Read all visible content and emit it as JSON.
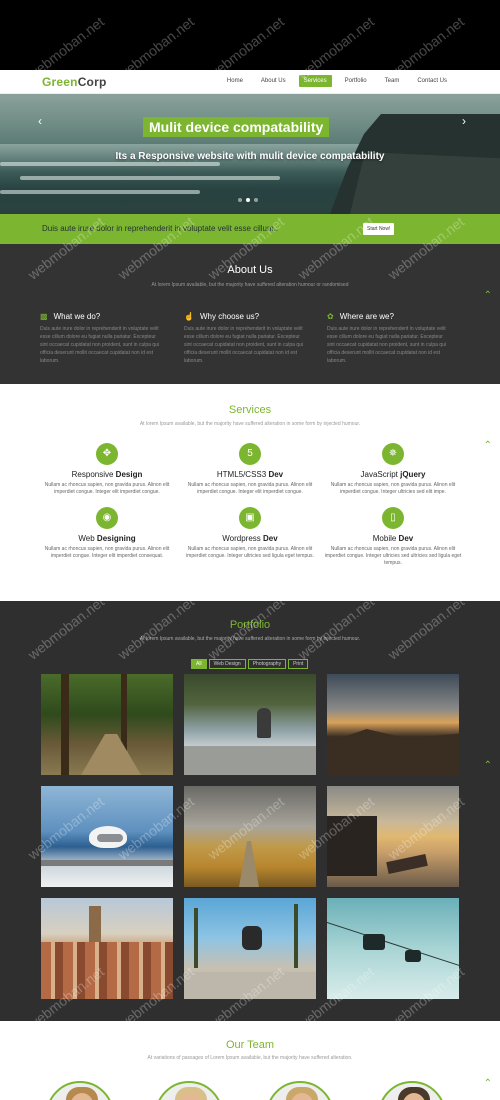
{
  "brand": {
    "part1": "Green",
    "part2": "Corp"
  },
  "nav": {
    "items": [
      {
        "label": "Home"
      },
      {
        "label": "About Us"
      },
      {
        "label": "Services",
        "active": true
      },
      {
        "label": "Portfolio"
      },
      {
        "label": "Team"
      },
      {
        "label": "Contact Us"
      }
    ]
  },
  "hero": {
    "title": "Mulit device compatability",
    "subtitle": "Its a Responsive website with mulit device compatability",
    "prev_icon": "chevron-left-icon",
    "next_icon": "chevron-right-icon",
    "slide_count": 3,
    "active_slide": 2
  },
  "cta": {
    "text": "Duis aute irure dolor in reprehenderit in voluptate velit esse cillum..",
    "button": "Start Now!"
  },
  "about": {
    "title": "About Us",
    "subtitle": "At lorem Ipsum available, but the majority have suffered alteration humour or randomised",
    "columns": [
      {
        "icon": "monitor-icon",
        "heading": "What we do?",
        "text": "Duis aute irure dolor in reprehenderit in voluptate velit esse cillum dolore eu fugiat nulla pariatur. Excepteur sint occaecat cupidatat non proident, sunt in culpa qui officia deserunt mollit occaecat cupidatat non id est laborum."
      },
      {
        "icon": "thumbs-up-icon",
        "heading": "Why choose us?",
        "text": "Duis aute irure dolor in reprehenderit in voluptate velit esse cillum dolore eu fugiat nulla pariatur. Excepteur sint occaecat cupidatat non proident, sunt in culpa qui officia deserunt mollit occaecat cupidatat non id est laborum."
      },
      {
        "icon": "leaf-icon",
        "heading": "Where are we?",
        "text": "Duis aute irure dolor in reprehenderit in voluptate velit esse cillum dolore eu fugiat nulla pariatur. Excepteur sint occaecat cupidatat non proident, sunt in culpa qui officia deserunt mollit occaecat cupidatat non id est laborum."
      }
    ]
  },
  "services": {
    "title": "Services",
    "subtitle": "At lorem Ipsum available, but the majority have suffered alteration in some form by injected humour.",
    "items": [
      {
        "icon": "arrows-icon",
        "name_a": "Responsive ",
        "name_b": "Design",
        "text": "Nullam ac rhoncus sapien, non gravida purus. Alinon elit imperdiet congue. Integer elit imperdiet congue."
      },
      {
        "icon": "html5-icon",
        "name_a": "HTML5/CSS3 ",
        "name_b": "Dev",
        "text": "Nullam ac rhoncus sapien, non gravida purus. Alinon elit imperdiet congue. Integer elit imperdiet congue."
      },
      {
        "icon": "lightbulb-icon",
        "name_a": "JavaScript ",
        "name_b": "jQuery",
        "text": "Nullam ac rhoncus sapien, non gravida purus. Alinon elit imperdiet congue. Integer ultricies sed elit impe."
      },
      {
        "icon": "globe-icon",
        "name_a": "Web ",
        "name_b": "Designing",
        "text": "Nullam ac rhoncus sapien, non gravida purus. Alinon elit imperdiet congue. Integer elit imperdiet consequat."
      },
      {
        "icon": "laptop-icon",
        "name_a": "Wordpress ",
        "name_b": "Dev",
        "text": "Nullam ac rhoncus sapien, non gravida purus. Alinon elit imperdiet congue. Integer ultricies sed ligula eget tempus."
      },
      {
        "icon": "tablet-icon",
        "name_a": "Mobile ",
        "name_b": "Dev",
        "text": "Nullam ac rhoncus sapien, non gravida purus. Alinon elit imperdiet congue. Integer ultricies sed ultricies sed ligula eget tempus."
      }
    ]
  },
  "portfolio": {
    "title": "Portfolio",
    "subtitle": "At lorem Ipsum available, but the majority have suffered alteration in some form by injected humour.",
    "filters": [
      {
        "label": "All",
        "active": true
      },
      {
        "label": "Web Design"
      },
      {
        "label": "Photography"
      },
      {
        "label": "Print"
      }
    ],
    "tiles": [
      "forest path",
      "man sitting by river",
      "mountain sunset",
      "seagull on beach",
      "golden field",
      "old pier at sunset",
      "city rooftops",
      "skateboarder with palms",
      "cable car in fog"
    ]
  },
  "team": {
    "title": "Our Team",
    "subtitle": "At variations of passages of Lorem Ipsum available, but the majority have suffered alteration."
  },
  "watermark": "webmoban.net",
  "colors": {
    "accent": "#7cb630",
    "dark": "#333333",
    "topbar": "#000000"
  }
}
